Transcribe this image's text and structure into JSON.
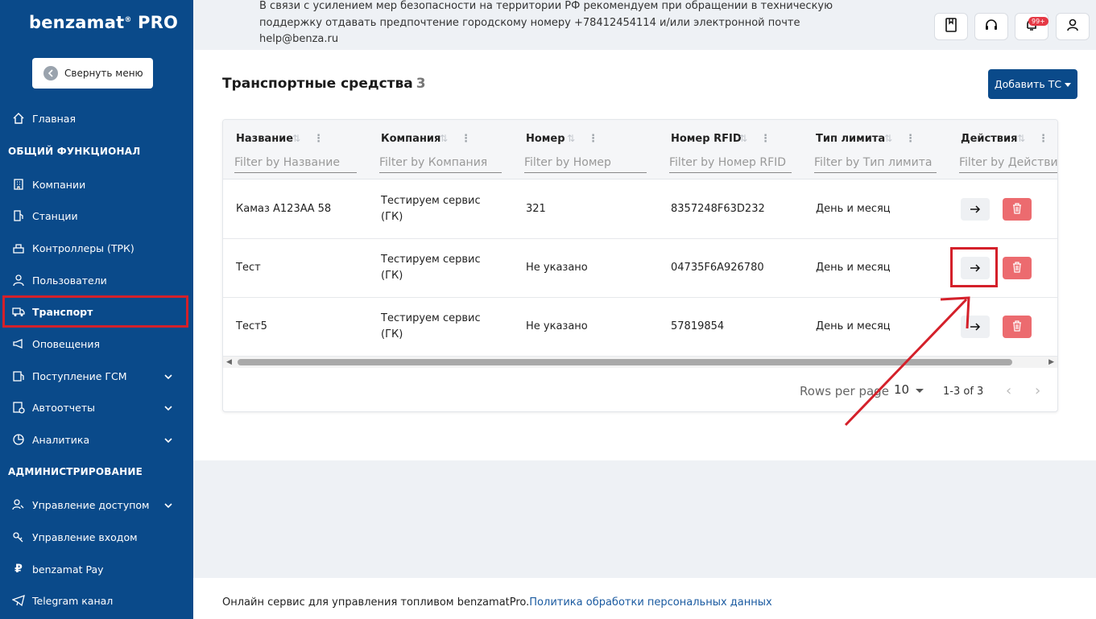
{
  "brand": {
    "logo_main": "benzamat",
    "logo_suffix": "PRO",
    "reg_mark": "®"
  },
  "sidebar": {
    "collapse_label": "Свернуть меню",
    "home": "Главная",
    "section_common": "ОБЩИЙ ФУНКЦИОНАЛ",
    "items": [
      {
        "label": "Компании",
        "icon": "building-icon"
      },
      {
        "label": "Станции",
        "icon": "station-icon"
      },
      {
        "label": "Контроллеры (ТРК)",
        "icon": "controller-icon"
      },
      {
        "label": "Пользователи",
        "icon": "user-icon"
      },
      {
        "label": "Транспорт",
        "icon": "truck-icon",
        "active": true
      },
      {
        "label": "Оповещения",
        "icon": "megaphone-icon"
      },
      {
        "label": "Поступление ГСМ",
        "icon": "fuel-intake-icon",
        "expandable": true
      },
      {
        "label": "Автоотчеты",
        "icon": "report-icon",
        "expandable": true
      },
      {
        "label": "Аналитика",
        "icon": "analytics-icon",
        "expandable": true
      }
    ],
    "section_admin": "АДМИНИСТРИРОВАНИЕ",
    "admin_items": [
      {
        "label": "Управление доступом",
        "icon": "access-icon",
        "expandable": true
      },
      {
        "label": "Управление входом",
        "icon": "key-icon"
      },
      {
        "label": "benzamat Pay",
        "icon": "ruble-icon"
      },
      {
        "label": "Telegram канал",
        "icon": "telegram-icon"
      }
    ]
  },
  "topbar": {
    "notice": "В связи с усилением мер безопасности на территории РФ рекомендуем при обращении в техническую поддержку отдавать предпочтение городскому номеру +78412454114 и/или электронной почте help@benza.ru",
    "notifications_badge": "99+"
  },
  "main": {
    "title": "Транспортные средства",
    "count": "3",
    "add_button": "Добавить ТС"
  },
  "table": {
    "columns": [
      {
        "title": "Название",
        "filter_placeholder": "Filter by Название"
      },
      {
        "title": "Компания",
        "filter_placeholder": "Filter by Компания"
      },
      {
        "title": "Номер",
        "filter_placeholder": "Filter by Номер"
      },
      {
        "title": "Номер RFID",
        "filter_placeholder": "Filter by Номер RFID"
      },
      {
        "title": "Тип лимита",
        "filter_placeholder": "Filter by Тип лимита"
      },
      {
        "title": "Действия",
        "filter_placeholder": "Filter by Действия"
      }
    ],
    "rows": [
      {
        "name": "Камаз А123АА 58",
        "company_line1": "Тестируем сервис",
        "company_line2": "(ГК)",
        "number": "321",
        "rfid": "8357248F63D232",
        "limit_type": "День и месяц"
      },
      {
        "name": "Тест",
        "company_line1": "Тестируем сервис",
        "company_line2": "(ГК)",
        "number": "Не указано",
        "rfid": "04735F6A926780",
        "limit_type": "День и месяц"
      },
      {
        "name": "Тест5",
        "company_line1": "Тестируем сервис",
        "company_line2": "(ГК)",
        "number": "Не указано",
        "rfid": "57819854",
        "limit_type": "День и месяц"
      }
    ],
    "rows_per_page_label": "Rows per page",
    "rows_per_page": "10",
    "range": "1-3 of 3"
  },
  "footer": {
    "text": "Онлайн сервис для управления топливом benzamatPro.",
    "link": "Политика обработки персональных данных"
  },
  "colors": {
    "sidebar": "#0a4a8a",
    "accent": "#0a4a8a",
    "danger": "#ec6b6f",
    "highlight": "#d4202a"
  }
}
